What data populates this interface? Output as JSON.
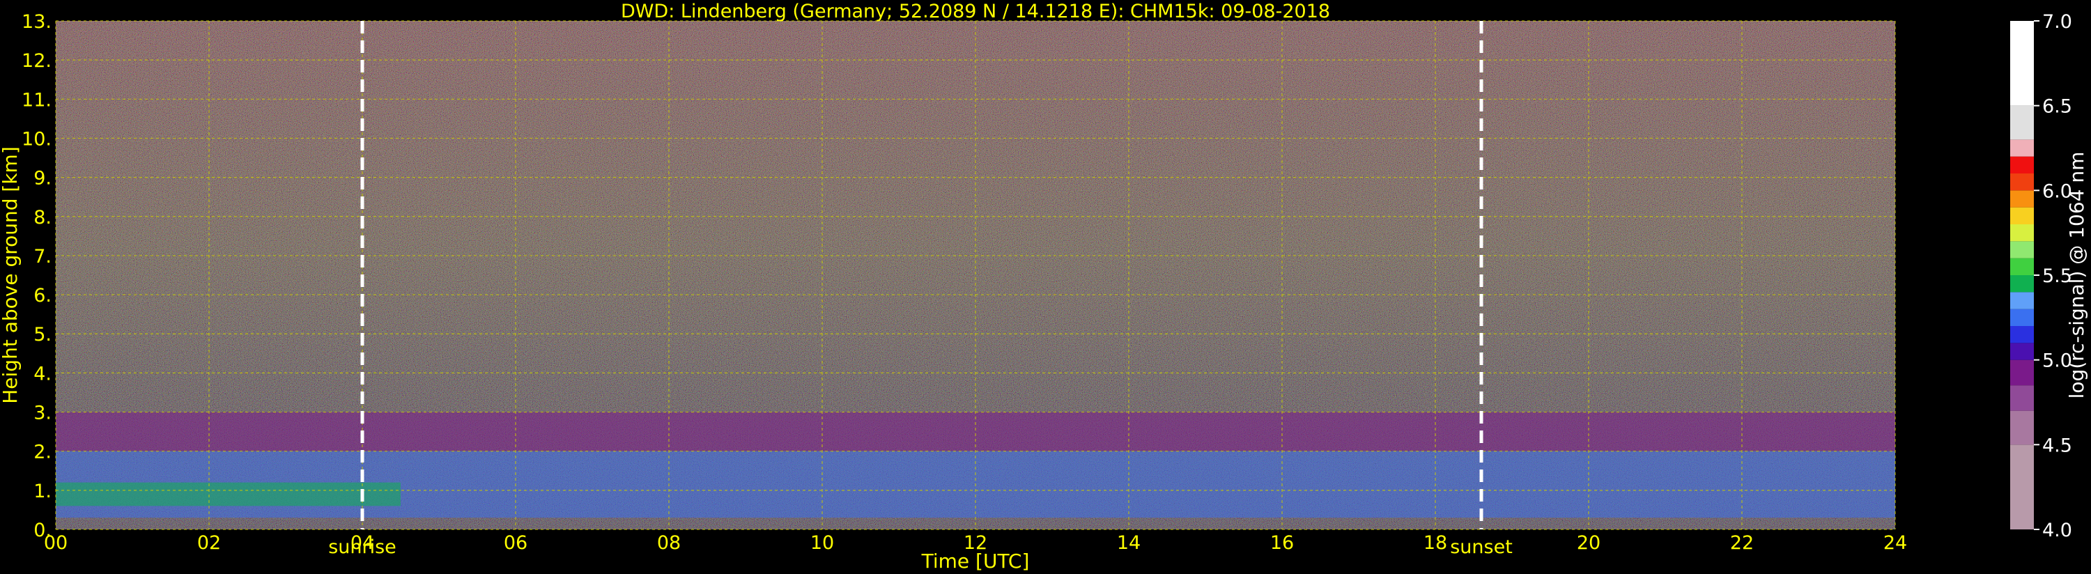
{
  "chart_data": {
    "type": "heatmap",
    "title": "DWD: Lindenberg (Germany; 52.2089 N / 14.1218 E):    CHM15k: 09-08-2018",
    "xlabel": "Time [UTC]",
    "ylabel": "Height above ground [km]",
    "xlim": [
      0,
      24
    ],
    "ylim": [
      0,
      13
    ],
    "x_ticks": [
      "00",
      "02",
      "04",
      "06",
      "08",
      "10",
      "12",
      "14",
      "16",
      "18",
      "20",
      "22",
      "24"
    ],
    "y_ticks": [
      "0.",
      "1.",
      "2.",
      "3.",
      "4.",
      "5.",
      "6.",
      "7.",
      "8.",
      "9.",
      "10.",
      "11.",
      "12.",
      "13."
    ],
    "grid": true,
    "events": [
      {
        "label": "sunrise",
        "x": 4.0
      },
      {
        "label": "sunset",
        "x": 18.6
      }
    ],
    "colorbar": {
      "label": "log(rc-signal) @ 1064 nm",
      "range": [
        4.0,
        7.0
      ],
      "ticks": [
        "4.0",
        "4.5",
        "5.0",
        "5.5",
        "6.0",
        "6.5",
        "7.0"
      ],
      "colors": [
        {
          "from": 4.0,
          "to": 4.5,
          "color": "#b89aaa"
        },
        {
          "from": 4.5,
          "to": 4.7,
          "color": "#a878a0"
        },
        {
          "from": 4.7,
          "to": 4.85,
          "color": "#904a98"
        },
        {
          "from": 4.85,
          "to": 5.0,
          "color": "#7a1a8a"
        },
        {
          "from": 5.0,
          "to": 5.1,
          "color": "#4a10b0"
        },
        {
          "from": 5.1,
          "to": 5.2,
          "color": "#2a30e0"
        },
        {
          "from": 5.2,
          "to": 5.3,
          "color": "#3a70f0"
        },
        {
          "from": 5.3,
          "to": 5.4,
          "color": "#60a0f8"
        },
        {
          "from": 5.4,
          "to": 5.5,
          "color": "#10b050"
        },
        {
          "from": 5.5,
          "to": 5.6,
          "color": "#40d040"
        },
        {
          "from": 5.6,
          "to": 5.7,
          "color": "#90e870"
        },
        {
          "from": 5.7,
          "to": 5.8,
          "color": "#d8f040"
        },
        {
          "from": 5.8,
          "to": 5.9,
          "color": "#f8d020"
        },
        {
          "from": 5.9,
          "to": 6.0,
          "color": "#f89010"
        },
        {
          "from": 6.0,
          "to": 6.1,
          "color": "#f04010"
        },
        {
          "from": 6.1,
          "to": 6.2,
          "color": "#f01010"
        },
        {
          "from": 6.2,
          "to": 6.3,
          "color": "#f0b0b8"
        },
        {
          "from": 6.3,
          "to": 6.5,
          "color": "#e0e0e0"
        },
        {
          "from": 6.5,
          "to": 7.0,
          "color": "#ffffff"
        }
      ]
    },
    "layers": [
      {
        "name": "aerosol-layer-top",
        "x": [
          0,
          24
        ],
        "y": [
          2.0,
          3.0
        ],
        "color": "#7a1a8a"
      },
      {
        "name": "boundary-layer",
        "x": [
          0,
          24
        ],
        "y": [
          0.3,
          2.0
        ],
        "color": "#3a70f0"
      },
      {
        "name": "residual-layer",
        "x": [
          0,
          4.5
        ],
        "y": [
          0.6,
          1.2
        ],
        "color": "#10b050"
      }
    ]
  }
}
